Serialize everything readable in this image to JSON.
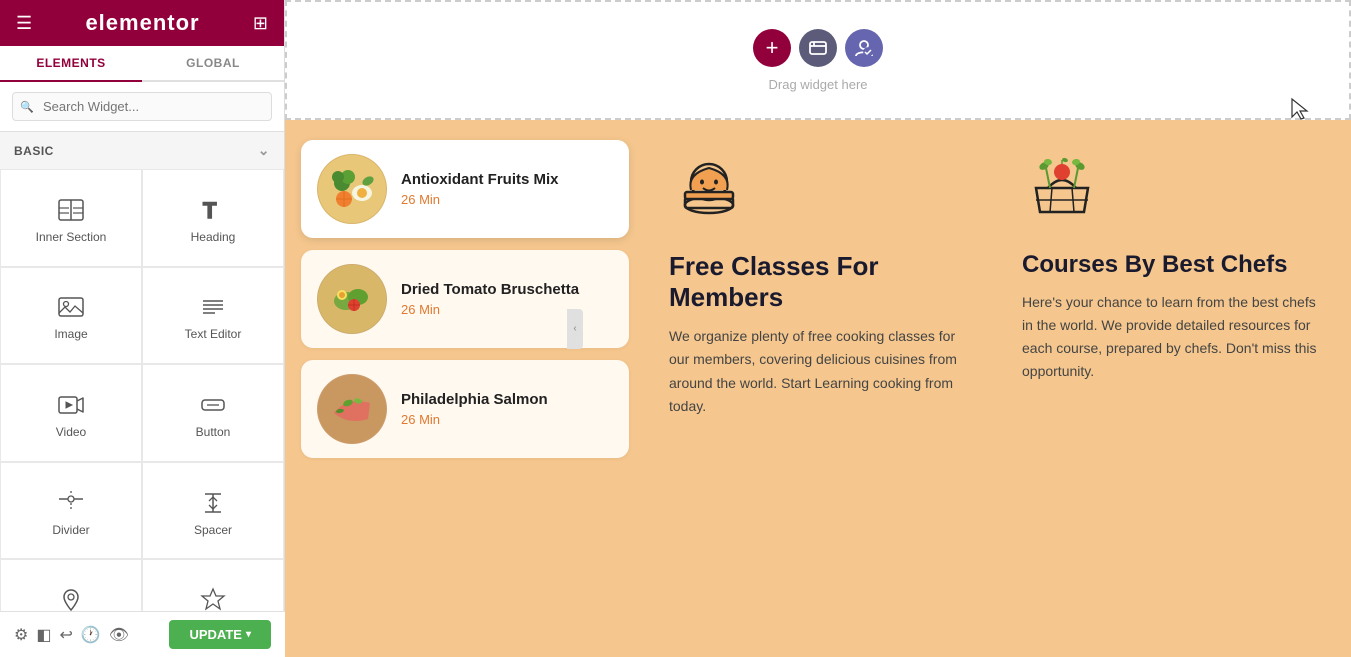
{
  "sidebar": {
    "logo": "elementor",
    "tabs": [
      {
        "label": "ELEMENTS",
        "active": true
      },
      {
        "label": "GLOBAL",
        "active": false
      }
    ],
    "search": {
      "placeholder": "Search Widget..."
    },
    "category": {
      "label": "BASIC",
      "collapsed": false
    },
    "widgets": [
      {
        "id": "inner-section",
        "label": "Inner Section",
        "icon": "inner-section-icon"
      },
      {
        "id": "heading",
        "label": "Heading",
        "icon": "heading-icon"
      },
      {
        "id": "image",
        "label": "Image",
        "icon": "image-icon"
      },
      {
        "id": "text-editor",
        "label": "Text Editor",
        "icon": "text-editor-icon"
      },
      {
        "id": "video",
        "label": "Video",
        "icon": "video-icon"
      },
      {
        "id": "button",
        "label": "Button",
        "icon": "button-icon"
      },
      {
        "id": "divider",
        "label": "Divider",
        "icon": "divider-icon"
      },
      {
        "id": "spacer",
        "label": "Spacer",
        "icon": "spacer-icon"
      },
      {
        "id": "google-maps",
        "label": "Google Maps",
        "icon": "google-maps-icon"
      },
      {
        "id": "icon",
        "label": "Icon",
        "icon": "icon-widget-icon"
      }
    ]
  },
  "toolbar": {
    "update_label": "UPDATE",
    "icons": [
      "settings",
      "layers",
      "undo",
      "history",
      "eye",
      "responsive"
    ]
  },
  "canvas": {
    "drag_hint": "Drag widget here",
    "drop_zone_border": "#cccccc"
  },
  "recipes": [
    {
      "name": "Antioxidant Fruits Mix",
      "time": "26 Min",
      "active": true,
      "emoji": "🥗"
    },
    {
      "name": "Dried Tomato Bruschetta",
      "time": "26 Min",
      "active": false,
      "emoji": "🥗"
    },
    {
      "name": "Philadelphia Salmon",
      "time": "26 Min",
      "active": false,
      "emoji": "🐟"
    }
  ],
  "free_classes": {
    "title": "Free Classes For Members",
    "description": "We organize plenty of free cooking classes for our members, covering delicious cuisines from around the world. Start Learning cooking from today."
  },
  "courses": {
    "title": "Courses By Best Chefs",
    "description": "Here's your chance to learn from the best chefs in the world. We provide detailed resources for each course, prepared by chefs. Don't miss this opportunity."
  },
  "colors": {
    "brand": "#92003b",
    "orange_bg": "#f5c78e",
    "recipe_card_bg": "#fff9f0",
    "recipe_card_active": "#ffffff",
    "orange_text": "#e07a30",
    "dark_text": "#1a1a2e",
    "update_btn": "#4caf50"
  }
}
